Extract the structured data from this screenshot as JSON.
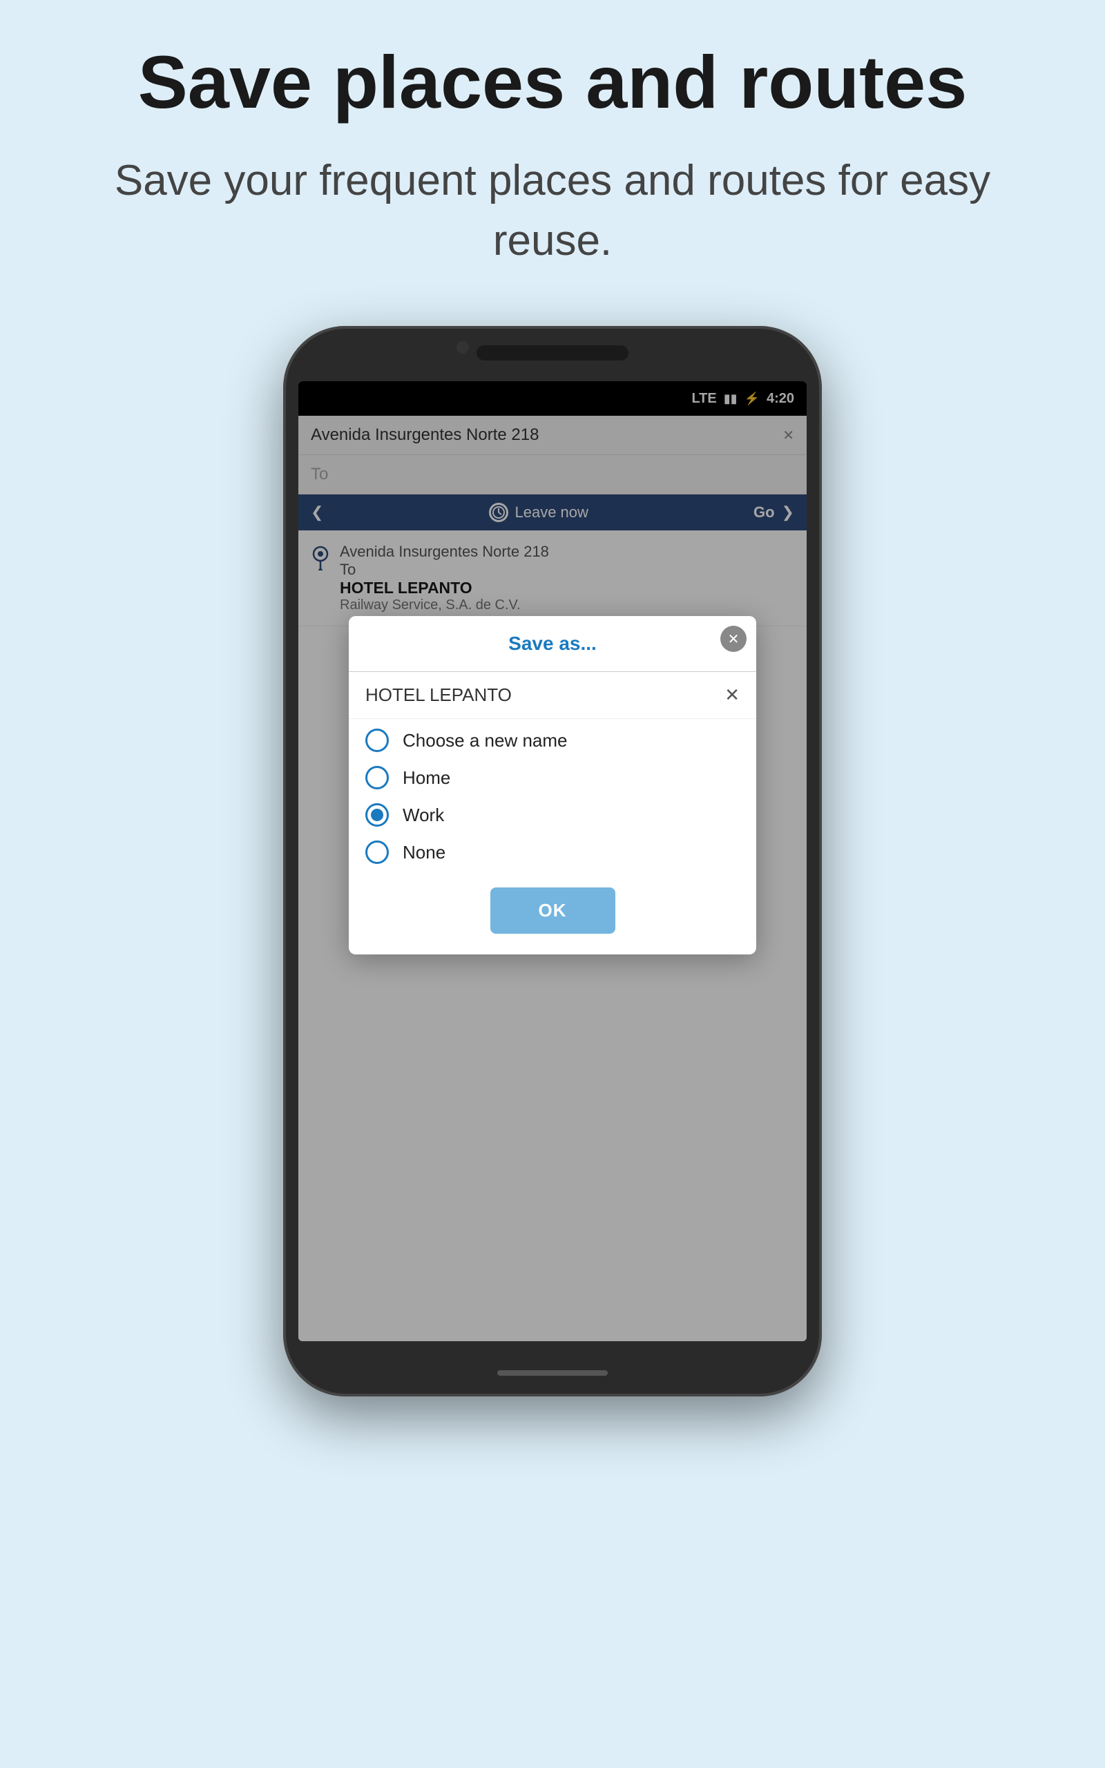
{
  "page": {
    "title": "Save places and routes",
    "subtitle": "Save your frequent places and routes for easy reuse."
  },
  "phone": {
    "status_bar": {
      "network": "LTE",
      "signal_icon": "▮▮",
      "battery_icon": "⚡",
      "time": "4:20"
    },
    "search": {
      "from_value": "Avenida Insurgentes Norte 218",
      "to_placeholder": "To",
      "close_icon": "✕"
    },
    "leave_now_bar": {
      "arrow_left": "❮",
      "clock_label": "⏰",
      "leave_now_text": "Leave now",
      "go_text": "Go",
      "arrow_right": "❯"
    },
    "route_info": {
      "from_label": "Avenida Insurgentes Norte 218",
      "to_label": "To",
      "destination_name": "HOTEL LEPANTO",
      "destination_sub": "Railway Service, S.A. de C.V."
    },
    "modal": {
      "title": "Save as...",
      "close_icon": "✕",
      "input_value": "HOTEL LEPANTO",
      "input_clear": "✕",
      "options": [
        {
          "id": "new_name",
          "label": "Choose a new name",
          "selected": false
        },
        {
          "id": "home",
          "label": "Home",
          "selected": false
        },
        {
          "id": "work",
          "label": "Work",
          "selected": true
        },
        {
          "id": "none",
          "label": "None",
          "selected": false
        }
      ],
      "ok_label": "OK"
    }
  }
}
